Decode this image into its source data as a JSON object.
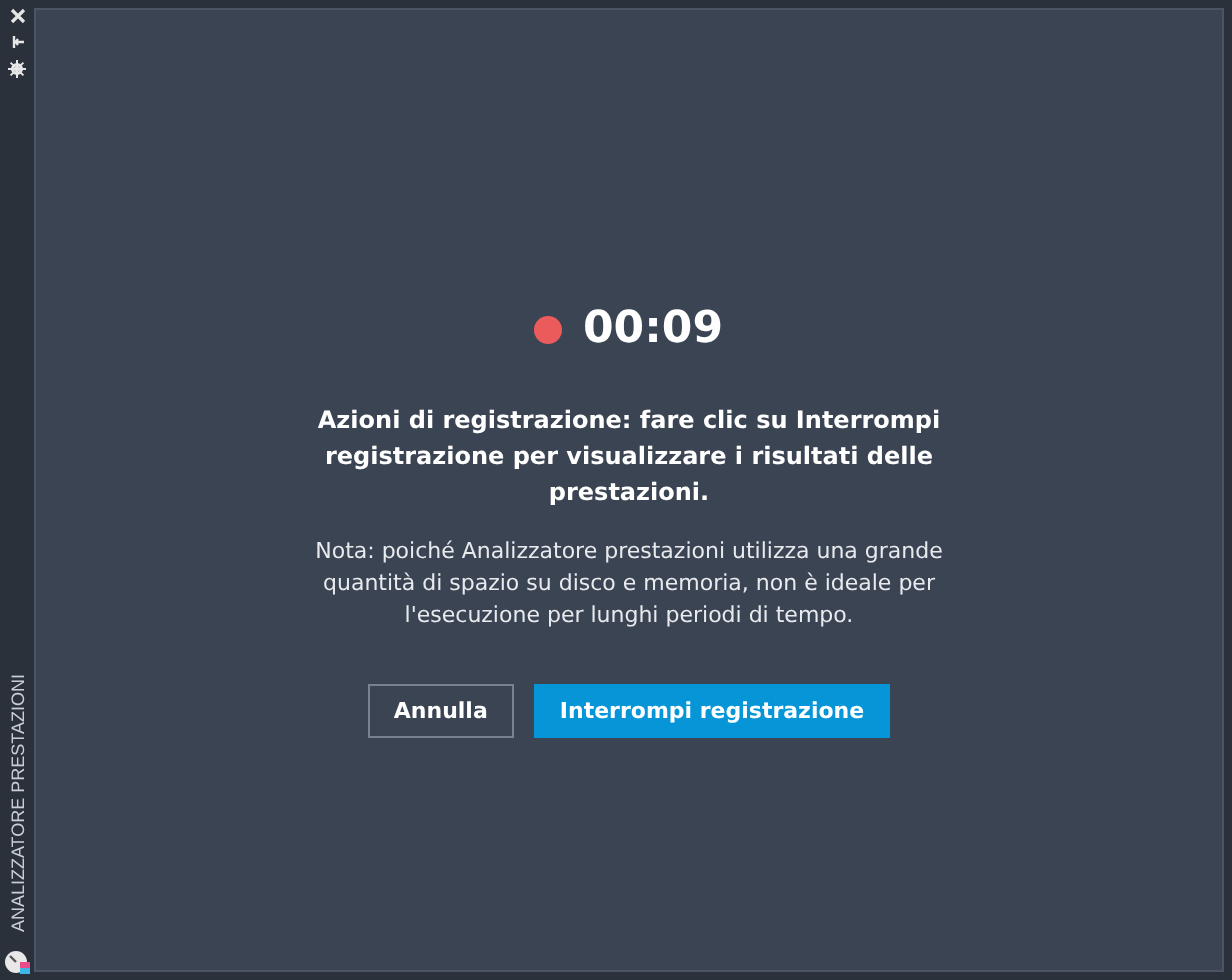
{
  "side_panel": {
    "title": "ANALIZZATORE PRESTAZIONI"
  },
  "recording": {
    "timer": "00:09",
    "heading": "Azioni di registrazione: fare clic su Interrompi registrazione per visualizzare i risultati delle prestazioni.",
    "note": "Nota: poiché Analizzatore prestazioni utilizza una grande quantità di spazio su disco e memoria, non è ideale per l'esecuzione per lunghi periodi di tempo."
  },
  "buttons": [
    {
      "label": "Annulla",
      "kind": "secondary"
    },
    {
      "label": "Interrompi registrazione",
      "kind": "primary"
    }
  ]
}
